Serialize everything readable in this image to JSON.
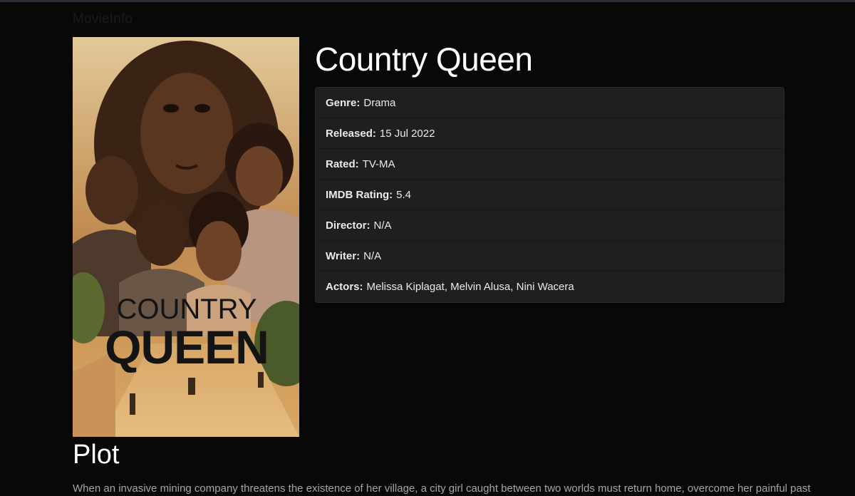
{
  "site": {
    "brand": "MovieInfo"
  },
  "movie": {
    "title": "Country Queen",
    "poster_text": {
      "line1": "COUNTRY",
      "line2": "QUEEN"
    },
    "details": [
      {
        "label": "Genre:",
        "value": "Drama"
      },
      {
        "label": "Released:",
        "value": "15 Jul 2022"
      },
      {
        "label": "Rated:",
        "value": "TV-MA"
      },
      {
        "label": "IMDB Rating:",
        "value": "5.4"
      },
      {
        "label": "Director:",
        "value": "N/A"
      },
      {
        "label": "Writer:",
        "value": "N/A"
      },
      {
        "label": "Actors:",
        "value": "Melissa Kiplagat, Melvin Alusa, Nini Wacera"
      }
    ],
    "plot_heading": "Plot",
    "plot": "When an invasive mining company threatens the existence of her village, a city girl caught between two worlds must return home, overcome her painful past"
  }
}
